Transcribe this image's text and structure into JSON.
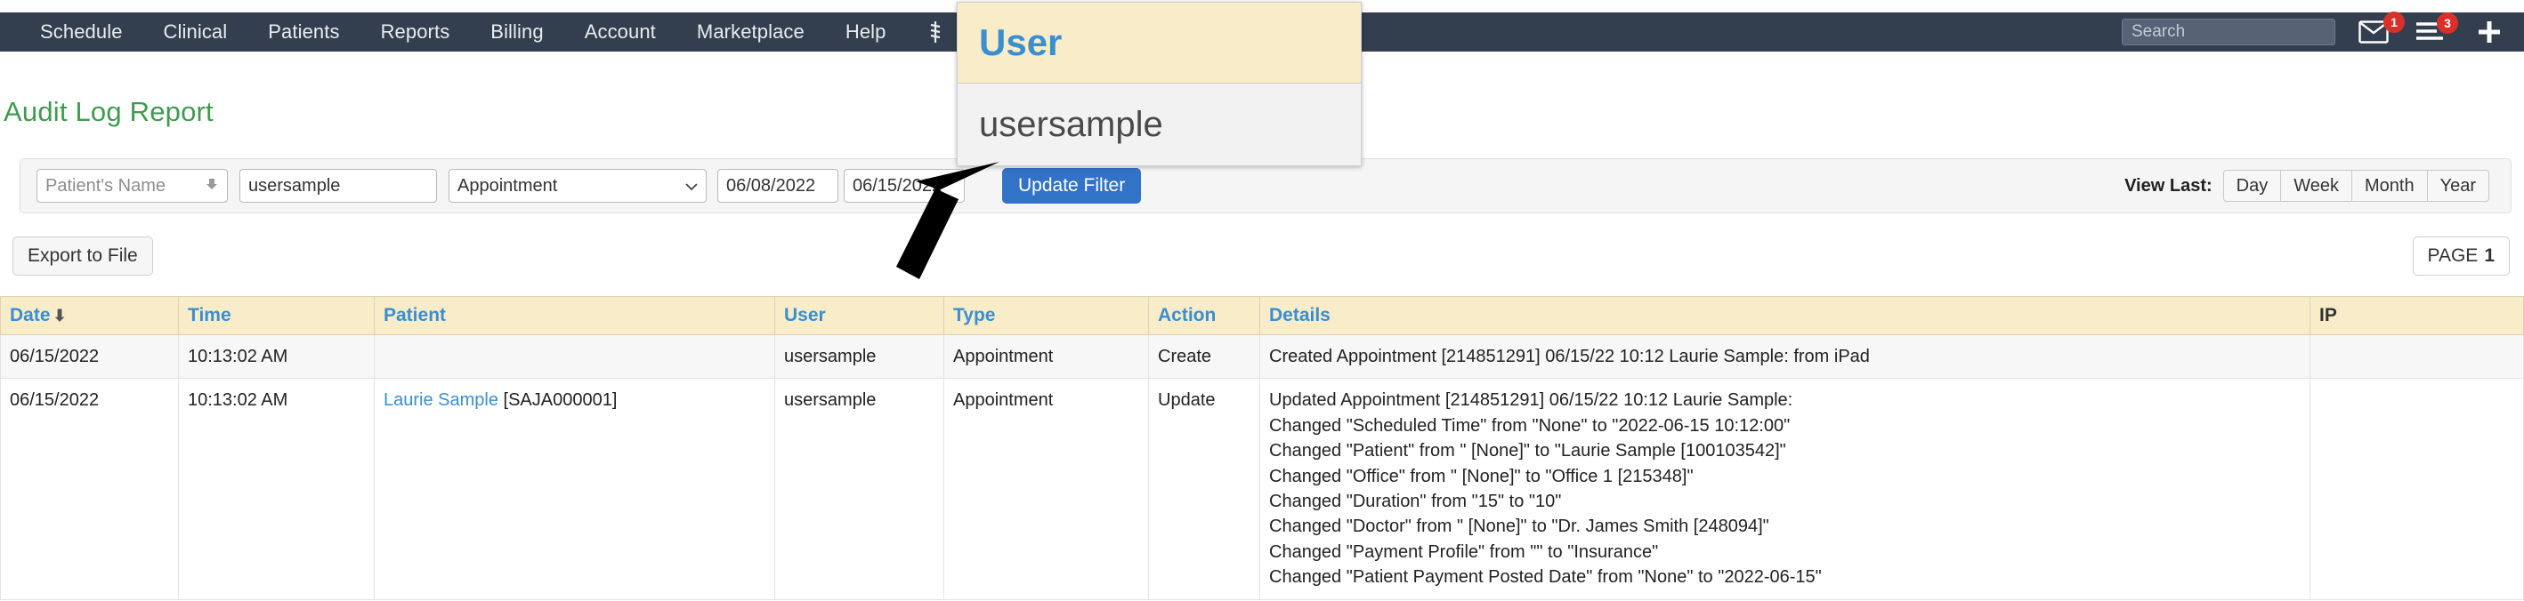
{
  "navbar": {
    "items": [
      {
        "label": "Schedule"
      },
      {
        "label": "Clinical"
      },
      {
        "label": "Patients"
      },
      {
        "label": "Reports"
      },
      {
        "label": "Billing"
      },
      {
        "label": "Account"
      },
      {
        "label": "Marketplace"
      },
      {
        "label": "Help"
      }
    ],
    "caduceus_icon": "caduceus-icon",
    "close_icon": "close-icon",
    "search_placeholder": "Search",
    "mail_badge": "1",
    "menu_badge": "3",
    "add_icon": "plus-icon",
    "background": "#333f4e"
  },
  "page": {
    "title": "Audit Log Report",
    "title_color": "#3f9b4f"
  },
  "filter": {
    "patient_name_placeholder": "Patient's Name",
    "user_value": "usersample",
    "type_value": "Appointment",
    "date_from": "06/08/2022",
    "date_to": "06/15/2022",
    "update_button": "Update Filter",
    "view_last_label": "View Last:",
    "view_last_options": [
      "Day",
      "Week",
      "Month",
      "Year"
    ]
  },
  "toolbar": {
    "export_label": "Export to File",
    "page_label": "PAGE",
    "page_number": "1"
  },
  "table": {
    "headers": [
      {
        "label": "Date",
        "sortable": true,
        "sort": "desc"
      },
      {
        "label": "Time",
        "sortable": true
      },
      {
        "label": "Patient",
        "sortable": true
      },
      {
        "label": "User",
        "sortable": true
      },
      {
        "label": "Type",
        "sortable": true
      },
      {
        "label": "Action",
        "sortable": true
      },
      {
        "label": "Details",
        "sortable": true
      },
      {
        "label": "IP",
        "sortable": false
      }
    ],
    "rows": [
      {
        "date": "06/15/2022",
        "time": "10:13:02 AM",
        "patient_link": "",
        "patient_id": "",
        "user": "usersample",
        "type": "Appointment",
        "action": "Create",
        "details": [
          "Created Appointment [214851291] 06/15/22 10:12 Laurie Sample: from iPad"
        ],
        "ip": ""
      },
      {
        "date": "06/15/2022",
        "time": "10:13:02 AM",
        "patient_link": "Laurie Sample",
        "patient_id": "[SAJA000001]",
        "user": "usersample",
        "type": "Appointment",
        "action": "Update",
        "details": [
          "Updated Appointment [214851291] 06/15/22 10:12 Laurie Sample:",
          "Changed \"Scheduled Time\" from \"None\" to \"2022-06-15 10:12:00\"",
          "Changed \"Patient\" from \" [None]\" to \"Laurie Sample [100103542]\"",
          "Changed \"Office\" from \" [None]\" to \"Office 1 [215348]\"",
          "Changed \"Duration\" from \"15\" to \"10\"",
          "Changed \"Doctor\" from \" [None]\" to \"Dr. James Smith [248094]\"",
          "Changed \"Payment Profile\" from \"\" to \"Insurance\"",
          "Changed \"Patient Payment Posted Date\" from \"None\" to \"2022-06-15\""
        ],
        "ip": ""
      }
    ]
  },
  "zoom_overlay": {
    "header_text": "User",
    "cell_text": "usersample"
  }
}
